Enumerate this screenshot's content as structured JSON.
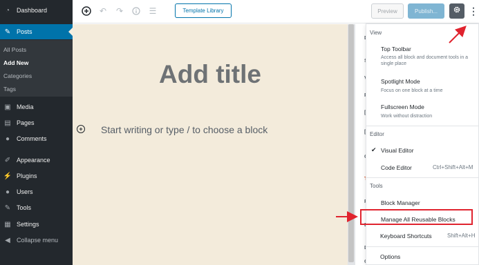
{
  "sidebar": {
    "dashboard": "Dashboard",
    "posts": "Posts",
    "sub": [
      "All Posts",
      "Add New",
      "Categories",
      "Tags"
    ],
    "media": "Media",
    "pages": "Pages",
    "comments": "Comments",
    "appearance": "Appearance",
    "plugins": "Plugins",
    "users": "Users",
    "tools": "Tools",
    "settings": "Settings",
    "collapse": "Collapse menu"
  },
  "toolbar": {
    "template_library": "Template Library",
    "preview": "Preview",
    "publish": "Publish..."
  },
  "editor": {
    "title_placeholder": "Add title",
    "block_placeholder": "Start writing or type / to choose a block"
  },
  "side_panel_letters": [
    "D",
    "S",
    "V",
    "P",
    "[",
    "[",
    "C",
    "T",
    "F",
    "E",
    "D",
    "C"
  ],
  "menu": {
    "view_group": "View",
    "top_toolbar": "Top Toolbar",
    "top_toolbar_desc": "Access all block and document tools in a single place",
    "spotlight": "Spotlight Mode",
    "spotlight_desc": "Focus on one block at a time",
    "fullscreen": "Fullscreen Mode",
    "fullscreen_desc": "Work without distraction",
    "editor_group": "Editor",
    "visual_editor": "Visual Editor",
    "code_editor": "Code Editor",
    "code_editor_shortcut": "Ctrl+Shift+Alt+M",
    "tools_group": "Tools",
    "block_manager": "Block Manager",
    "manage_reusable": "Manage All Reusable Blocks",
    "keyboard_shortcuts": "Keyboard Shortcuts",
    "keyboard_shortcut_keys": "Shift+Alt+H",
    "options": "Options"
  },
  "colors": {
    "sidebar_bg": "#23282d",
    "active_blue": "#0073aa",
    "canvas_bg": "#f3ebdb",
    "highlight_red": "#e0232e"
  }
}
